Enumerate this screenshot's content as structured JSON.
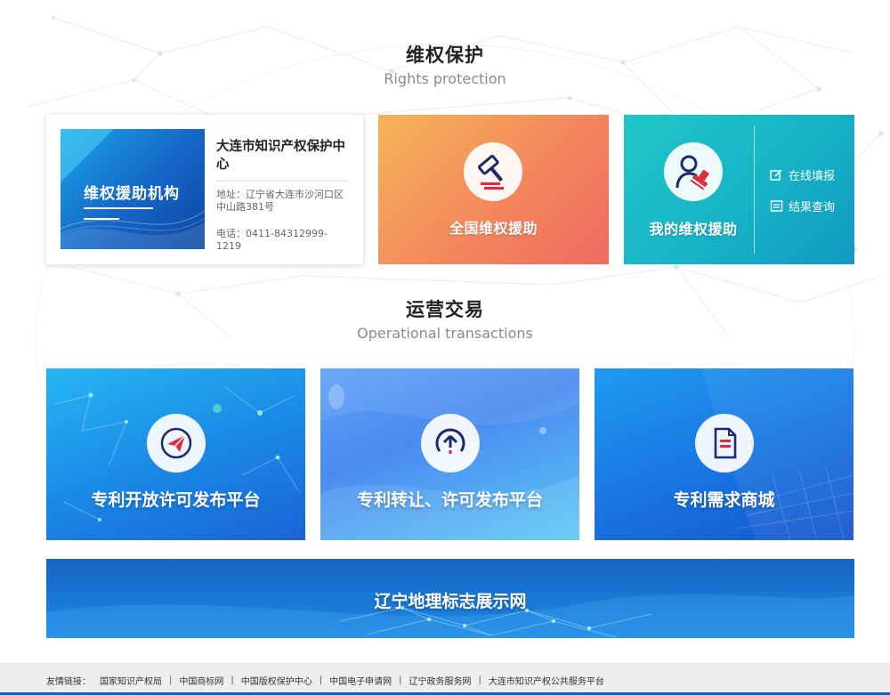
{
  "rights": {
    "title_cn": "维权保护",
    "title_en": "Rights protection",
    "org": {
      "banner_text": "维权援助机构",
      "name": "大连市知识产权保护中心",
      "address": "地址：辽宁省大连市沙河口区中山路381号",
      "phone": "电话：0411-84312999-1219"
    },
    "national_aid": {
      "label": "全国维权援助",
      "icon": "gavel-icon"
    },
    "my_aid": {
      "label": "我的维权援助",
      "icon": "user-stamp-icon",
      "links": [
        {
          "label": "在线填报",
          "icon": "edit-icon"
        },
        {
          "label": "结果查询",
          "icon": "list-icon"
        }
      ]
    }
  },
  "transactions": {
    "title_cn": "运营交易",
    "title_en": "Operational transactions",
    "cards": [
      {
        "label": "专利开放许可发布平台",
        "icon": "paper-plane-icon"
      },
      {
        "label": "专利转让、许可发布平台",
        "icon": "upload-arrow-icon"
      },
      {
        "label": "专利需求商城",
        "icon": "document-icon"
      }
    ],
    "geo": {
      "label": "辽宁地理标志展示网"
    }
  },
  "footer": {
    "label": "友情链接：",
    "links": [
      "国家知识产权局",
      "中国商标网",
      "中国版权保护中心",
      "中国电子申请网",
      "辽宁政务服务网",
      "大连市知识产权公共服务平台"
    ]
  },
  "colors": {
    "icon_navy": "#1b2a6b",
    "icon_red": "#e02b3a",
    "footer_bar": "#1a5fb4"
  }
}
